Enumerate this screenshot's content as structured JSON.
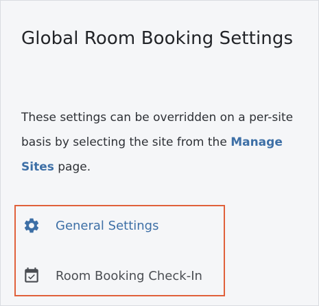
{
  "page": {
    "title": "Global Room Booking Settings",
    "description_before": "These settings can be overridden on a per-site basis by selecting the site from the ",
    "manage_sites_link": "Manage Sites",
    "description_after": " page."
  },
  "nav": {
    "items": [
      {
        "label": "General Settings",
        "icon": "gear-icon",
        "color": "#3d6fa6"
      },
      {
        "label": "Room Booking Check-In",
        "icon": "calendar-check-icon",
        "color": "#4a4d52"
      }
    ]
  },
  "colors": {
    "accent": "#3d6fa6",
    "highlight_border": "#e0603a",
    "background": "#f5f6f8"
  }
}
